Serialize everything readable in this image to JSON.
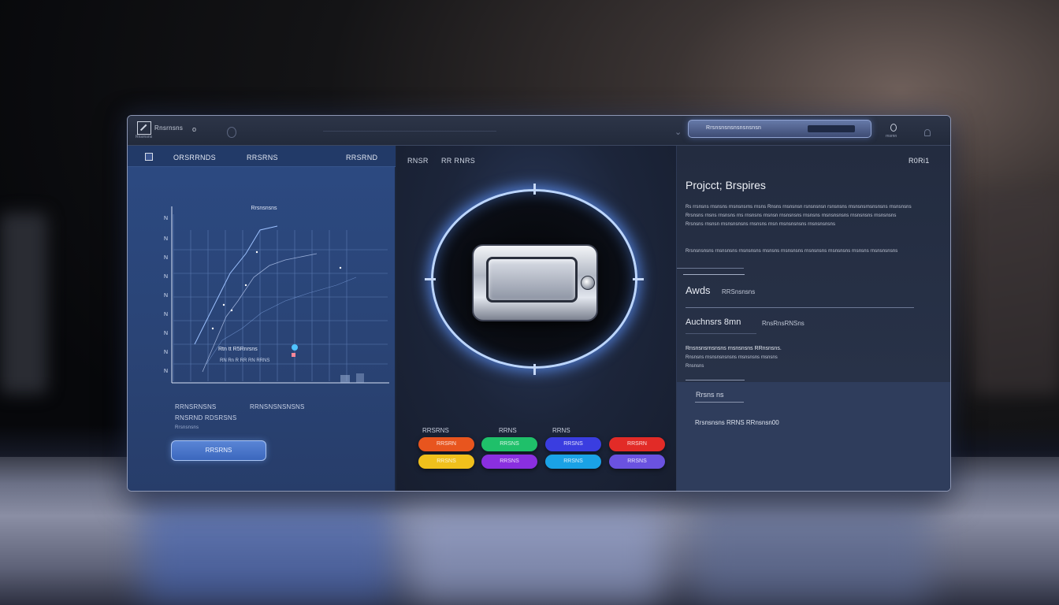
{
  "window": {
    "app_title": "Rnsrnsns",
    "app_sub": "Rnsrnsns",
    "circle_glyph": "o",
    "search_text": "Rrsnsnsnsnsnsnsnsn",
    "user_label": "rnsrnn"
  },
  "left_panel": {
    "tabs": [
      "ORSRRNDS",
      "RRSRNS",
      "RRSRND"
    ],
    "chart_title": "Rrsnsnsns",
    "chart_legend_1": "Rtn tt  R5Rnrsns",
    "chart_legend_2": "RN Rn R  RR RN RRNS",
    "caption_1": "RRNSRNSNS",
    "caption_2": "RRNSNSNSNSNS",
    "caption_3": "RNSRND RDSRSNS",
    "caption_4": "Rrsnsnsns",
    "button_label": "RRSRNS"
  },
  "center_panel": {
    "tabs": [
      "RNSR",
      "RR RNRS"
    ],
    "pill_labels": [
      "RRSRNS",
      "RRNS",
      "RRNS"
    ],
    "pills": [
      {
        "label": "RRSRN",
        "color": "#e8551e"
      },
      {
        "label": "RRSNS",
        "color": "#1fc06a"
      },
      {
        "label": "RRSNS",
        "color": "#3a3de0"
      },
      {
        "label": "RRSRN",
        "color": "#e22b27"
      },
      {
        "label": "RRSNS",
        "color": "#f0c01c"
      },
      {
        "label": "RRSNS",
        "color": "#8a2fe0"
      },
      {
        "label": "RRSNS",
        "color": "#1aa2e6"
      },
      {
        "label": "RRSNS",
        "color": "#6a52e0"
      }
    ]
  },
  "right_panel": {
    "id_label": "R0Ri1",
    "title": "Projcct; Brspires",
    "para_1": "Rs rrsnsns rnsnsns rnsnsnsrns rnsns Rnsns rnsnsnsn rsnsnsnsn rsnsnsns rnsnsnsrnsnsnsns rnsnsnsns",
    "para_2": "Rrsnsns rnsns rnsnsns rns rnsnsns rnsnsn rnsnsnsns rnsnsns rnsnsnsnsns rnsnsnsns rnsnsnsns",
    "para_3": "Rrsnsns rnsnsn rnsnsnsnsns rnsnsns rnsn rnsnsnsnsns rnsnsnsnsns",
    "para_4": "Rrsnsnsnsns rnsnsnsns rnsnsnsns rnsnsns rnsnsnsns rnsnsnsns rnsnsnsns rnsnsns rnsnsnsnsns",
    "heading_1": "Awds",
    "heading_1_sub": "RRSnsnsns",
    "heading_2": "Auchnsrs 8mn",
    "heading_2_sub": "RnsRnsRNSns",
    "detail_1": "Rnsnsnsrnsnsns rnsnsnsns RRnsnsns.",
    "detail_2": "Rnsnsns rnsnsnsnsnsns rnsnsnsns rnsnsns",
    "detail_3": "Rnsnsns",
    "lower_1": "Rrsns ns",
    "lower_2": "Rrsnsnsns RRNS RRnsnsn00"
  }
}
